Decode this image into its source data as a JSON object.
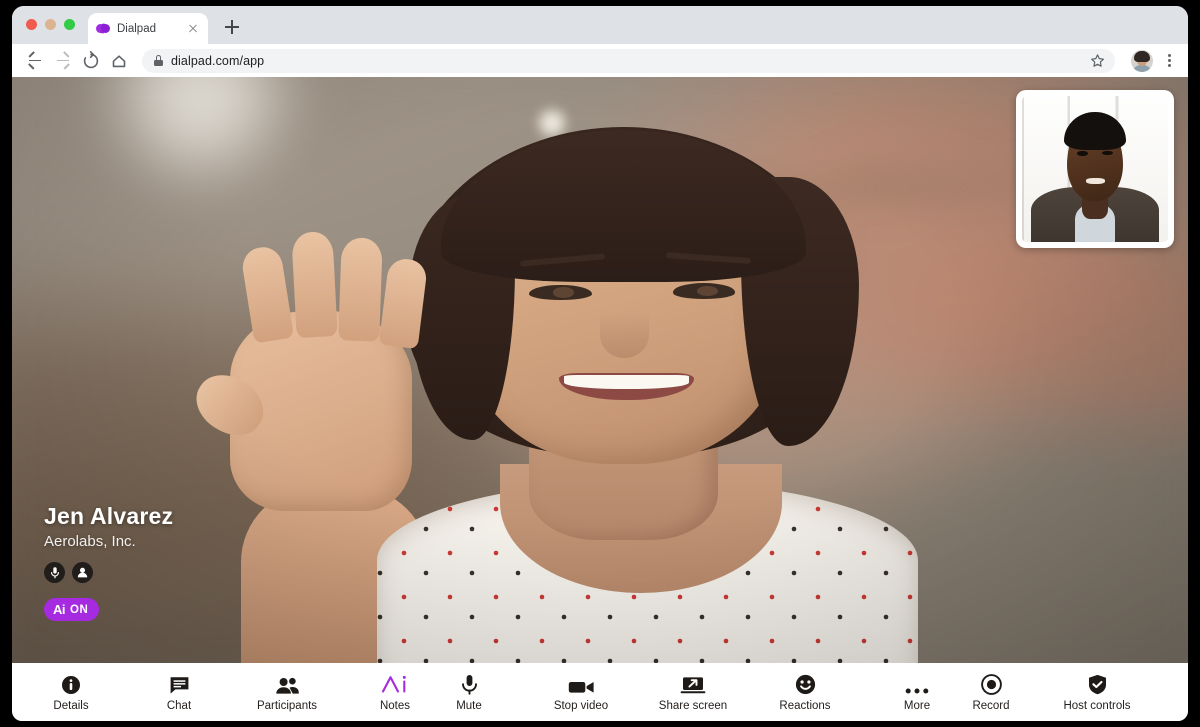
{
  "browser": {
    "traffic_lights": [
      "close",
      "minimize",
      "zoom"
    ],
    "tab": {
      "title": "Dialpad",
      "favicon": "dialpad-logo-icon",
      "close": "close-tab-icon"
    },
    "new_tab_label": "+",
    "nav": {
      "back": "back-arrow-icon",
      "forward": "forward-arrow-icon",
      "reload": "reload-icon",
      "home": "home-icon"
    },
    "omnibox": {
      "lock": "lock-icon",
      "url": "dialpad.com/app",
      "bookmark": "star-icon"
    },
    "profile": "profile-avatar",
    "menu": "kebab-menu-icon"
  },
  "call": {
    "participant": {
      "name": "Jen Alvarez",
      "org": "Aerolabs, Inc.",
      "badges": [
        "microphone-icon",
        "person-icon"
      ]
    },
    "ai_badge": {
      "mark": "Ai",
      "state": "ON",
      "color": "#a62ae0"
    },
    "self_view": {
      "label": "self-view-thumbnail"
    }
  },
  "controls": {
    "left": [
      {
        "id": "details",
        "label": "Details",
        "icon": "info-icon"
      },
      {
        "id": "chat",
        "label": "Chat",
        "icon": "chat-bubble-icon"
      },
      {
        "id": "participants",
        "label": "Participants",
        "icon": "participants-icon"
      },
      {
        "id": "notes",
        "label": "Notes",
        "icon": "ai-notes-icon",
        "accent": "#a62ae0"
      }
    ],
    "center": [
      {
        "id": "mute",
        "label": "Mute",
        "icon": "microphone-icon"
      },
      {
        "id": "stop-video",
        "label": "Stop video",
        "icon": "video-camera-icon"
      },
      {
        "id": "share-screen",
        "label": "Share screen",
        "icon": "share-screen-icon"
      },
      {
        "id": "reactions",
        "label": "Reactions",
        "icon": "smiley-icon"
      },
      {
        "id": "more",
        "label": "More",
        "icon": "ellipsis-icon"
      }
    ],
    "right": [
      {
        "id": "record",
        "label": "Record",
        "icon": "record-icon"
      },
      {
        "id": "host-controls",
        "label": "Host controls",
        "icon": "shield-check-icon"
      }
    ],
    "end_call": {
      "id": "end-call",
      "icon": "end-call-icon",
      "color": "#ef4a46"
    }
  }
}
